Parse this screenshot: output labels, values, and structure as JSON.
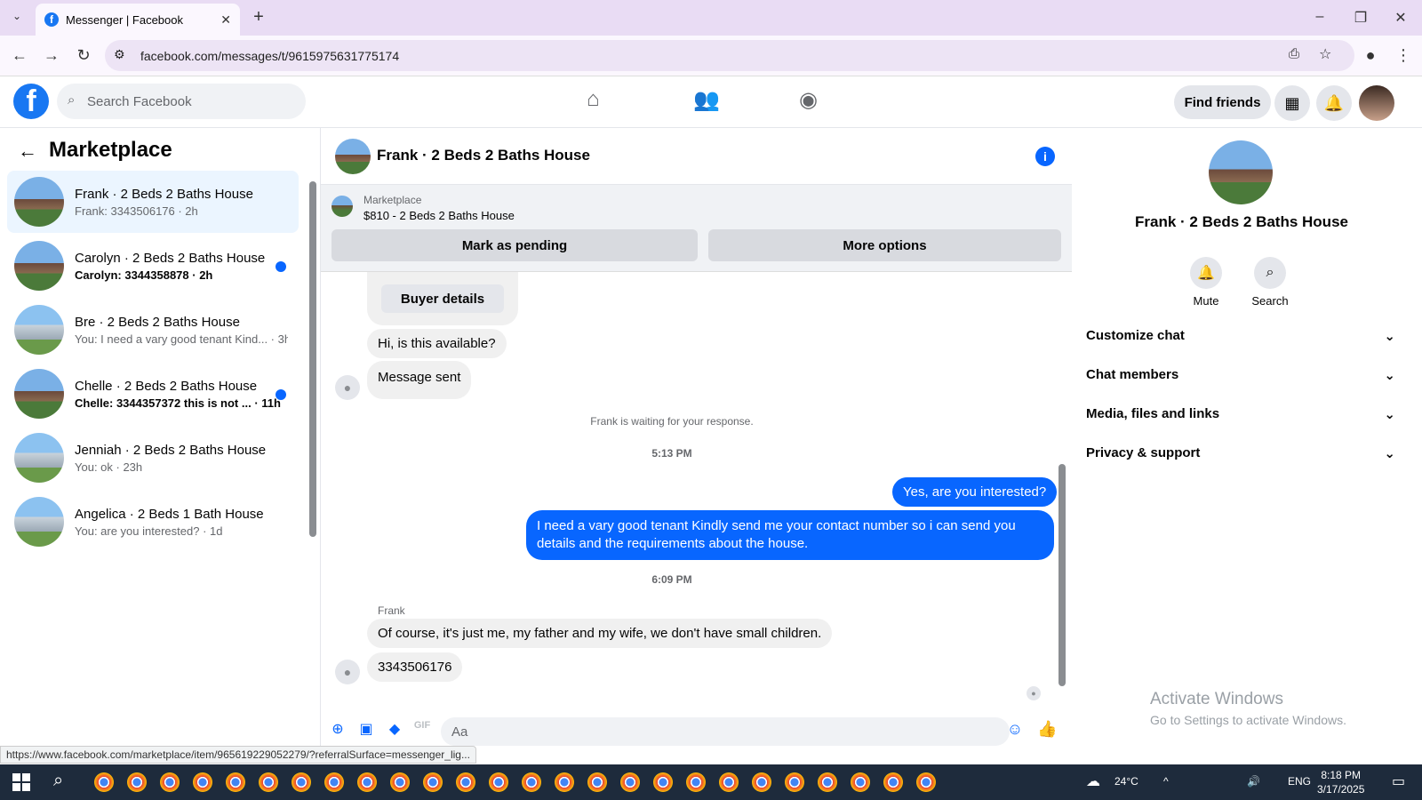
{
  "browser": {
    "tab_title": "Messenger | Facebook",
    "url": "facebook.com/messages/t/9615975631775174",
    "status_url": "https://www.facebook.com/marketplace/item/965619229052279/?referralSurface=messenger_lig..."
  },
  "header": {
    "search_placeholder": "Search Facebook",
    "find_friends": "Find friends"
  },
  "left": {
    "title": "Marketplace",
    "conversations": [
      {
        "name": "Frank · 2 Beds 2 Baths House",
        "preview": "Frank: 3343506176 · 2h",
        "unread": false,
        "selected": true
      },
      {
        "name": "Carolyn · 2 Beds 2 Baths House",
        "preview": "Carolyn: 3344358878 · 2h",
        "unread": true,
        "selected": false
      },
      {
        "name": "Bre · 2 Beds 2 Baths House",
        "preview": "You: I need a vary good tenant Kind... · 3h",
        "unread": false,
        "selected": false
      },
      {
        "name": "Chelle · 2 Beds 2 Baths House",
        "preview": "Chelle: 3344357372 this is not ... · 11h",
        "unread": true,
        "selected": false
      },
      {
        "name": "Jenniah · 2 Beds 2 Baths House",
        "preview": "You: ok · 23h",
        "unread": false,
        "selected": false
      },
      {
        "name": "Angelica · 2 Beds 1 Bath House",
        "preview": "You: are you interested? · 1d",
        "unread": false,
        "selected": false
      }
    ]
  },
  "chat": {
    "title": "Frank · 2 Beds 2 Baths House",
    "marketplace_label": "Marketplace",
    "listing": "$810 - 2 Beds 2 Baths House",
    "mark_pending": "Mark as pending",
    "more_options": "More options",
    "buyer_details": "Buyer details",
    "msg1": "Hi, is this available?",
    "msg2": "Message sent",
    "waiting": "Frank is waiting for your response.",
    "time1": "5:13 PM",
    "me1": "Yes, are you interested?",
    "me2": "I need a vary good tenant Kindly send me your contact number so i can send you details and the requirements about the house.",
    "time2": "6:09 PM",
    "sender": "Frank",
    "msg3": "Of course, it's just me, my father and my wife, we don't have small children.",
    "msg4": "3343506176",
    "composer_placeholder": "Aa"
  },
  "right": {
    "title": "Frank · 2 Beds 2 Baths House",
    "mute": "Mute",
    "search": "Search",
    "sections": [
      "Customize chat",
      "Chat members",
      "Media, files and links",
      "Privacy & support"
    ]
  },
  "os": {
    "activate1": "Activate Windows",
    "activate2": "Go to Settings to activate Windows.",
    "temp": "24°C",
    "lang": "ENG",
    "time": "8:18 PM",
    "date": "3/17/2025"
  }
}
